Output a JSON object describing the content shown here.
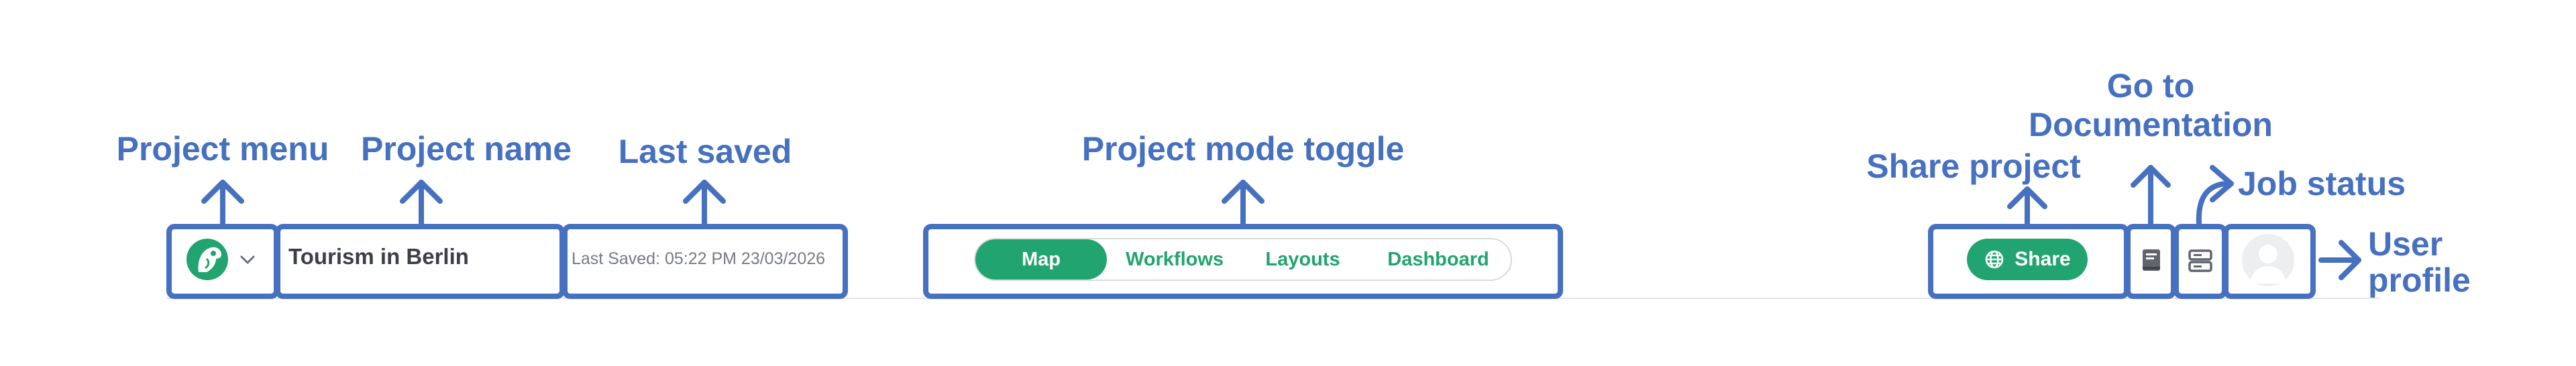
{
  "annotations": {
    "project_menu": "Project menu",
    "project_name": "Project name",
    "last_saved": "Last saved",
    "project_mode_toggle": "Project mode toggle",
    "share_project": "Share project",
    "go_to_documentation_line1": "Go to",
    "go_to_documentation_line2": "Documentation",
    "job_status": "Job status",
    "user_profile_line1": "User",
    "user_profile_line2": "profile"
  },
  "toolbar": {
    "project_name": "Tourism in Berlin",
    "last_saved": "Last Saved: 05:22 PM 23/03/2026",
    "modes": [
      {
        "label": "Map",
        "active": true
      },
      {
        "label": "Workflows",
        "active": false
      },
      {
        "label": "Layouts",
        "active": false
      },
      {
        "label": "Dashboard",
        "active": false
      }
    ],
    "share_label": "Share"
  },
  "icons": {
    "logo": "parrot-logo-icon",
    "menu": "chevron-down-icon",
    "share": "globe-icon",
    "docs": "book-icon",
    "jobs": "server-icon",
    "user": "user-avatar-icon"
  },
  "colors": {
    "accent": "#21a46f",
    "annotation": "#4670c0",
    "text": "#3b4047",
    "muted": "#767b82"
  }
}
